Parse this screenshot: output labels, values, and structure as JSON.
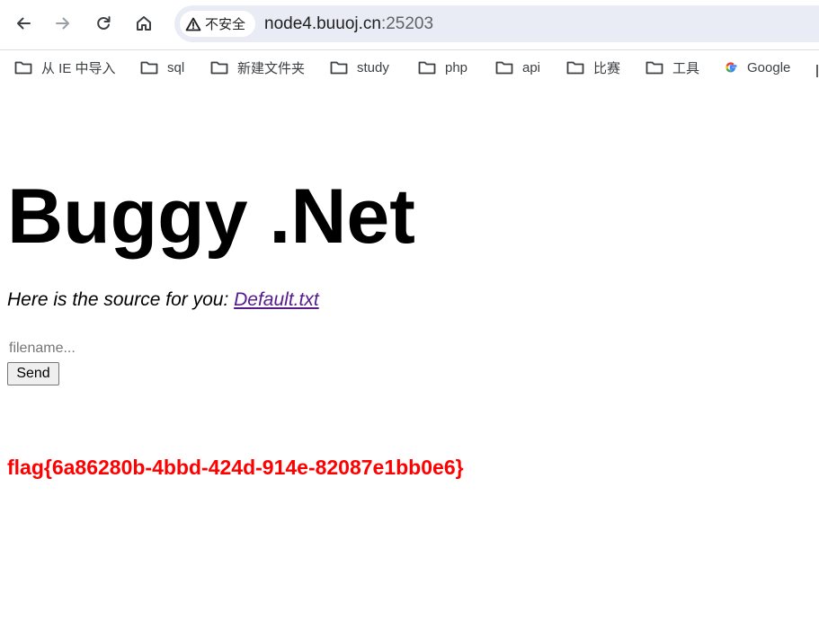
{
  "toolbar": {
    "security_label": "不安全",
    "url_host": "node4.buuoj.cn",
    "url_port": ":25203"
  },
  "bookmarks": [
    {
      "label": "从 IE 中导入",
      "icon": "folder-icon"
    },
    {
      "label": "sql",
      "icon": "folder-icon"
    },
    {
      "label": "新建文件夹",
      "icon": "folder-icon"
    },
    {
      "label": "study",
      "icon": "folder-icon"
    },
    {
      "label": "php",
      "icon": "folder-icon"
    },
    {
      "label": "api",
      "icon": "folder-icon"
    },
    {
      "label": "比赛",
      "icon": "folder-icon"
    },
    {
      "label": "工具",
      "icon": "folder-icon"
    },
    {
      "label": "Google",
      "icon": "google-icon"
    }
  ],
  "page": {
    "title": "Buggy .Net",
    "intro_text": "Here is the source for you: ",
    "source_link": "Default.txt",
    "filename_placeholder": "filename...",
    "filename_value": "",
    "send_label": "Send",
    "flag": "flag{6a86280b-4bbd-424d-914e-82087e1bb0e6}"
  },
  "colors": {
    "flag": "#ff0000",
    "link_visited": "#551a8b",
    "omnibox_bg": "#e9ecf5"
  }
}
